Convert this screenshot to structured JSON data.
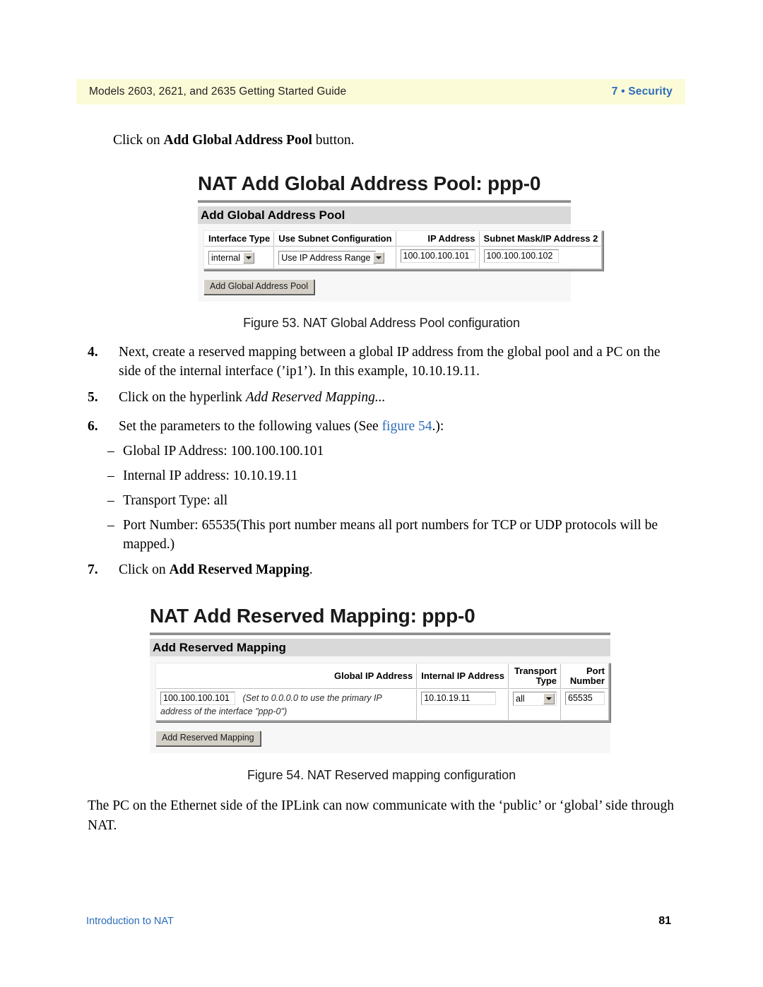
{
  "header": {
    "left": "Models 2603, 2621, and 2635 Getting Started Guide",
    "right": "7 • Security"
  },
  "intro": {
    "prefix": "Click on ",
    "bold": "Add Global Address Pool",
    "suffix": " button."
  },
  "figure53": {
    "page_title": "NAT Add Global Address Pool: ppp-0",
    "panel_title": "Add Global Address Pool",
    "columns": [
      "Interface Type",
      "Use Subnet Configuration",
      "IP Address",
      "Subnet Mask/IP Address 2"
    ],
    "fields": {
      "interface_type": "internal",
      "use_subnet_configuration": "Use IP Address Range",
      "ip_address": "100.100.100.101",
      "subnet_mask_ip_address_2": "100.100.100.102"
    },
    "submit_label": "Add Global Address Pool",
    "caption": "Figure 53. NAT Global Address Pool configuration"
  },
  "steps": [
    {
      "number": "4.",
      "text": "Next, create a reserved mapping between a global IP address from the global pool and a PC on the side of the internal interface (’ip1’). In this example, 10.10.19.11."
    },
    {
      "number": "5.",
      "plain": "Click on the hyperlink ",
      "italic": "Add Reserved Mapping...",
      "tail": ""
    },
    {
      "number": "6.",
      "plain": "Set the parameters to the following values (See ",
      "link": "figure 54",
      "tail": ".):"
    },
    {
      "number": "7.",
      "plain": "Click on ",
      "bold": "Add Reserved Mapping",
      "tail": "."
    }
  ],
  "bullets": [
    "Global IP Address: 100.100.100.101",
    "Internal IP address: 10.10.19.11",
    "Transport Type: all",
    "Port Number: 65535(This port number means all port numbers for TCP or UDP protocols will be mapped.)"
  ],
  "figure54": {
    "page_title": "NAT Add Reserved Mapping: ppp-0",
    "panel_title": "Add Reserved Mapping",
    "columns": [
      "",
      "Global IP Address",
      "Internal IP Address",
      "Transport Type",
      "Port Number"
    ],
    "columns_wrapped": {
      "transport": [
        "Transport",
        "Type"
      ],
      "port": [
        "Port",
        "Number"
      ]
    },
    "fields": {
      "global_ip_address": "100.100.100.101",
      "global_ip_hint": "(Set to 0.0.0.0 to use the primary IP address of the interface \"ppp-0\")",
      "internal_ip_address": "10.10.19.11",
      "transport_type": "all",
      "port_number": "65535"
    },
    "submit_label": "Add Reserved Mapping",
    "caption": "Figure 54. NAT Reserved mapping configuration"
  },
  "closing_paragraph": "The PC on the Ethernet side of the IPLink can now communicate with the ‘public’ or ‘global’ side through NAT.",
  "footer": {
    "left": "Introduction to NAT",
    "right": "81"
  }
}
